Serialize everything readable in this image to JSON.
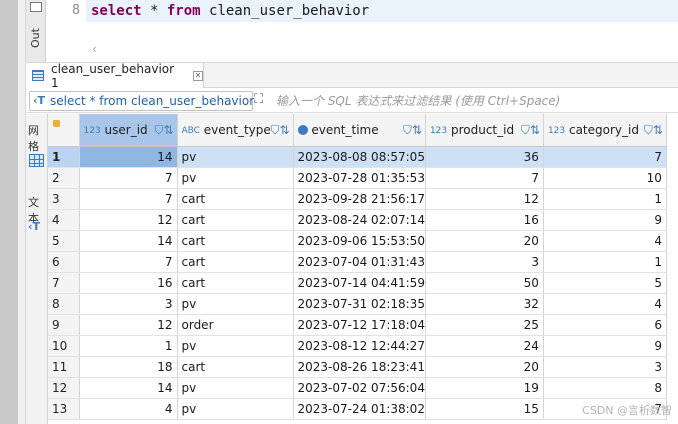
{
  "editor": {
    "line_number": "8",
    "code": {
      "kw1": "select",
      "mid": " * ",
      "kw2": "from",
      "rest": " clean_user_behavior"
    },
    "side_tab": "Out",
    "scroll_arrow": "‹"
  },
  "results_tab": {
    "label": "clean_user_behavior 1",
    "close": "✕"
  },
  "filter": {
    "query": "select * from clean_user_behavior",
    "placeholder": "输入一个 SQL 表达式来过滤结果 (使用 Ctrl+Space)"
  },
  "side_panel": {
    "grid_label": "网格",
    "text_label": "文本"
  },
  "columns": [
    {
      "type": "123",
      "name": "user_id"
    },
    {
      "type": "ABC",
      "name": "event_type"
    },
    {
      "type": "clock",
      "name": "event_time"
    },
    {
      "type": "123",
      "name": "product_id"
    },
    {
      "type": "123",
      "name": "category_id"
    }
  ],
  "rows": [
    [
      "1",
      "14",
      "pv",
      "2023-08-08 08:57:05",
      "36",
      "7"
    ],
    [
      "2",
      "7",
      "pv",
      "2023-07-28 01:35:53",
      "7",
      "10"
    ],
    [
      "3",
      "7",
      "cart",
      "2023-09-28 21:56:17",
      "12",
      "1"
    ],
    [
      "4",
      "12",
      "cart",
      "2023-08-24 02:07:14",
      "16",
      "9"
    ],
    [
      "5",
      "14",
      "cart",
      "2023-09-06 15:53:50",
      "20",
      "4"
    ],
    [
      "6",
      "7",
      "cart",
      "2023-07-04 01:31:43",
      "3",
      "1"
    ],
    [
      "7",
      "16",
      "cart",
      "2023-07-14 04:41:59",
      "50",
      "5"
    ],
    [
      "8",
      "3",
      "pv",
      "2023-07-31 02:18:35",
      "32",
      "4"
    ],
    [
      "9",
      "12",
      "order",
      "2023-07-12 17:18:04",
      "25",
      "6"
    ],
    [
      "10",
      "1",
      "pv",
      "2023-08-12 12:44:27",
      "24",
      "9"
    ],
    [
      "11",
      "18",
      "cart",
      "2023-08-26 18:23:41",
      "20",
      "3"
    ],
    [
      "12",
      "14",
      "pv",
      "2023-07-02 07:56:04",
      "19",
      "8"
    ],
    [
      "13",
      "4",
      "pv",
      "2023-07-24 01:38:02",
      "15",
      "7"
    ]
  ],
  "watermark": "CSDN @言析数智"
}
